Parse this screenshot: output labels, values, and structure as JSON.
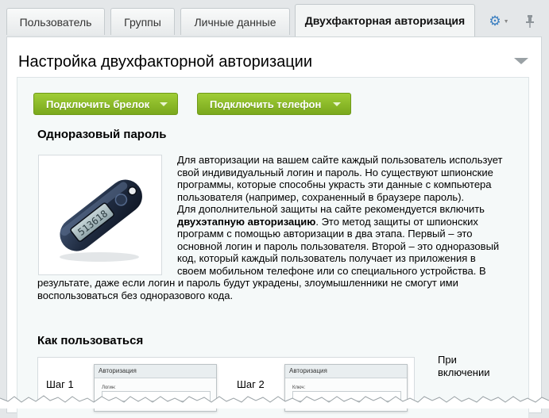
{
  "tabs": [
    {
      "label": "Пользователь"
    },
    {
      "label": "Группы"
    },
    {
      "label": "Личные данные"
    },
    {
      "label": "Двухфакторная авторизация",
      "active": true
    }
  ],
  "toolbar_icons": [
    "gear-icon",
    "pin-icon"
  ],
  "panel": {
    "title": "Настройка двухфакторной авторизации"
  },
  "buttons": {
    "connect_keyfob": "Подключить брелок",
    "connect_phone": "Подключить телефон"
  },
  "otp": {
    "heading": "Одноразовый пароль",
    "image_alt": "Брелок с одноразовым паролем",
    "device_display": "513618",
    "p1": "Для авторизации на вашем сайте каждый пользователь использует свой индивидуальный логин и пароль. Но существуют шпионские программы, которые способны украсть эти данные с компьютера пользователя (например, сохраненный в браузере пароль).",
    "p2_before": "Для дополнительной защиты на сайте рекомендуется включить ",
    "p2_bold": "двухэтапную авторизацию",
    "p2_after": ". Это метод защиты от шпионских программ с помощью авторизации в два этапа. Первый – это основной логин и пароль пользователя. Второй – это одноразовый код, который каждый пользователь получает из приложения в своем мобильном телефоне или со специального устройства. В результате, даже если логин и пароль будут украдены, злоумышленники не смогут ими воспользоваться без одноразового кода."
  },
  "howto": {
    "heading": "Как пользоваться",
    "steps": [
      {
        "label": "Шаг 1",
        "window_title": "Авторизация",
        "field_label": "Логин:"
      },
      {
        "label": "Шаг 2",
        "window_title": "Авторизация",
        "field_label": "Ключ:"
      }
    ],
    "side_text": [
      "При",
      "включении"
    ]
  },
  "colors": {
    "accent_green": "#8bbb2a",
    "gear_blue": "#3a7ec0"
  }
}
